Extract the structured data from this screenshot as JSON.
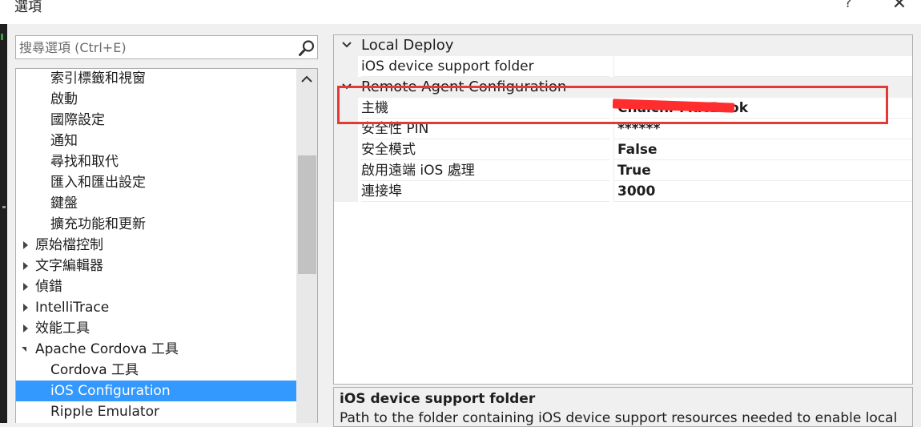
{
  "window": {
    "title": "選項",
    "help_label": "?",
    "close_label": "✕"
  },
  "search": {
    "placeholder": "搜尋選項 (Ctrl+E)",
    "value": ""
  },
  "tree": {
    "items": [
      {
        "label": "索引標籤和視窗",
        "indent": 2,
        "arrow": "none",
        "selected": false
      },
      {
        "label": "啟動",
        "indent": 2,
        "arrow": "none",
        "selected": false
      },
      {
        "label": "國際設定",
        "indent": 2,
        "arrow": "none",
        "selected": false
      },
      {
        "label": "通知",
        "indent": 2,
        "arrow": "none",
        "selected": false
      },
      {
        "label": "尋找和取代",
        "indent": 2,
        "arrow": "none",
        "selected": false
      },
      {
        "label": "匯入和匯出設定",
        "indent": 2,
        "arrow": "none",
        "selected": false
      },
      {
        "label": "鍵盤",
        "indent": 2,
        "arrow": "none",
        "selected": false
      },
      {
        "label": "擴充功能和更新",
        "indent": 2,
        "arrow": "none",
        "selected": false
      },
      {
        "label": "原始檔控制",
        "indent": 1,
        "arrow": "collapsed",
        "selected": false
      },
      {
        "label": "文字編輯器",
        "indent": 1,
        "arrow": "collapsed",
        "selected": false
      },
      {
        "label": "偵錯",
        "indent": 1,
        "arrow": "collapsed",
        "selected": false
      },
      {
        "label": "IntelliTrace",
        "indent": 1,
        "arrow": "collapsed",
        "selected": false
      },
      {
        "label": "效能工具",
        "indent": 1,
        "arrow": "collapsed",
        "selected": false
      },
      {
        "label": "Apache Cordova 工具",
        "indent": 1,
        "arrow": "expanded",
        "selected": false
      },
      {
        "label": "Cordova 工具",
        "indent": 2,
        "arrow": "none",
        "selected": false
      },
      {
        "label": "iOS Configuration",
        "indent": 2,
        "arrow": "none",
        "selected": true
      },
      {
        "label": "Ripple Emulator",
        "indent": 2,
        "arrow": "none",
        "selected": false
      }
    ]
  },
  "grid": {
    "categories": [
      {
        "label": "Local Deploy",
        "properties": [
          {
            "name": "iOS device support folder",
            "value": ""
          }
        ]
      },
      {
        "label": "Remote Agent Configuration",
        "properties": [
          {
            "name": "主機",
            "value": "Chaichi-MacBook"
          },
          {
            "name": "安全性 PIN",
            "value": "******"
          },
          {
            "name": "安全模式",
            "value": "False"
          },
          {
            "name": "啟用遠端 iOS 處理",
            "value": "True"
          },
          {
            "name": "連接埠",
            "value": "3000"
          }
        ]
      }
    ]
  },
  "description": {
    "title": "iOS device support folder",
    "text": "Path to the folder containing iOS device support resources needed to enable local"
  },
  "colors": {
    "selection": "#3399ff",
    "annotation": "#e53935"
  }
}
